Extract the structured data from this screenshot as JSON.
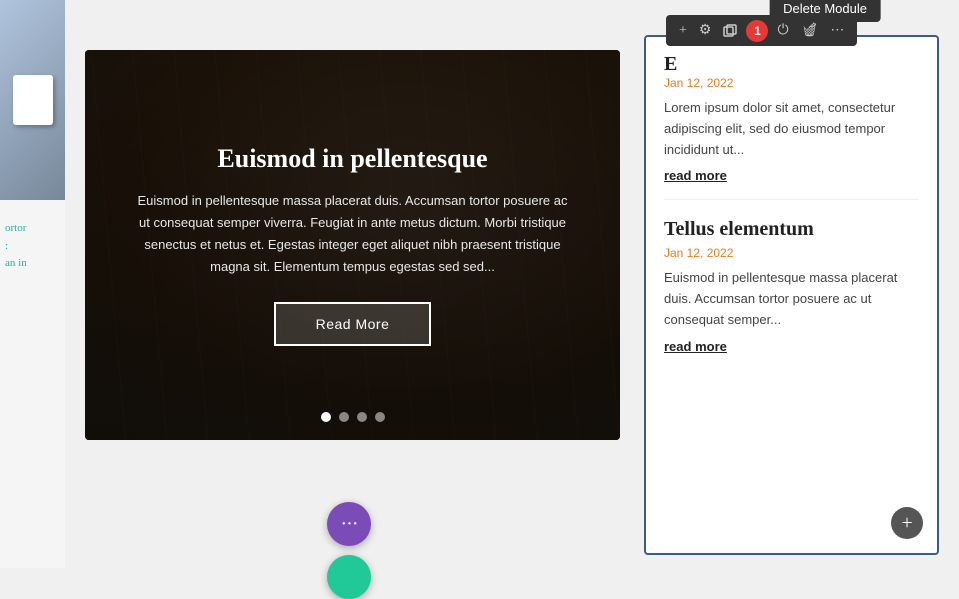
{
  "left_panel": {
    "text_lines": [
      "ortor",
      ":",
      "an in"
    ]
  },
  "slider": {
    "title": "Euismod in pellentesque",
    "body": "Euismod in pellentesque massa placerat duis. Accumsan tortor posuere ac ut consequat semper viverra. Feugiat in ante metus dictum. Morbi tristique senectus et netus et. Egestas integer eget aliquet nibh praesent tristique magna sit. Elementum tempus egestas sed sed...",
    "button_label": "Read More",
    "dots": [
      true,
      false,
      false,
      false
    ]
  },
  "fab_purple": {
    "icon": "···"
  },
  "right_panel": {
    "delete_tooltip": "Delete Module",
    "toolbar_badge": "1",
    "posts": [
      {
        "title_partial": "E",
        "date": "Jan 12, 2022",
        "excerpt": "Lorem ipsum dolor sit amet, consectetur adipiscing elit, sed do eiusmod tempor incididunt ut...",
        "read_more": "read more"
      },
      {
        "title": "Tellus elementum",
        "date": "Jan 12, 2022",
        "excerpt": "Euismod in pellentesque massa placerat duis. Accumsan tortor posuere ac ut consequat semper...",
        "read_more": "read more"
      }
    ],
    "add_btn": "+"
  },
  "toolbar": {
    "icons": [
      "+",
      "⚙",
      "⧉",
      "⏻",
      "🗑",
      "⋯"
    ]
  }
}
